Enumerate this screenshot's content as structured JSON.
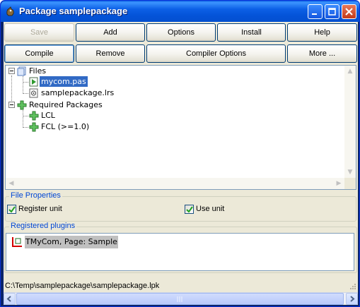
{
  "window": {
    "title": "Package samplepackage"
  },
  "toolbar": {
    "row1": [
      {
        "label": "Save",
        "disabled": true
      },
      {
        "label": "Add"
      },
      {
        "label": "Options"
      },
      {
        "label": "Install"
      },
      {
        "label": "Help"
      }
    ],
    "row2": [
      {
        "label": "Compile",
        "focused": true
      },
      {
        "label": "Remove"
      },
      {
        "label": "Compiler Options"
      },
      {
        "label": "More ..."
      }
    ]
  },
  "tree": {
    "files_label": "Files",
    "files": [
      {
        "label": "mycom.pas",
        "selected": true,
        "icon": "pascal-file-icon"
      },
      {
        "label": "samplepackage.lrs",
        "icon": "resource-file-icon"
      }
    ],
    "required_label": "Required Packages",
    "required": [
      {
        "label": "LCL",
        "icon": "package-icon"
      },
      {
        "label": "FCL (>=1.0)",
        "icon": "package-icon"
      }
    ]
  },
  "file_properties": {
    "title": "File Properties",
    "register_unit": {
      "label": "Register unit",
      "checked": true
    },
    "use_unit": {
      "label": "Use unit",
      "checked": true
    }
  },
  "registered_plugins": {
    "title": "Registered plugins",
    "items": [
      {
        "label": "TMyCom, Page: Sample",
        "icon": "component-icon"
      }
    ]
  },
  "status": {
    "path": "C:\\Temp\\samplepackage\\samplepackage.lpk"
  },
  "colors": {
    "titlebar": "#0453d8",
    "selection": "#316ac5",
    "group_title": "#0046d5",
    "window_bg": "#ece9d8"
  }
}
